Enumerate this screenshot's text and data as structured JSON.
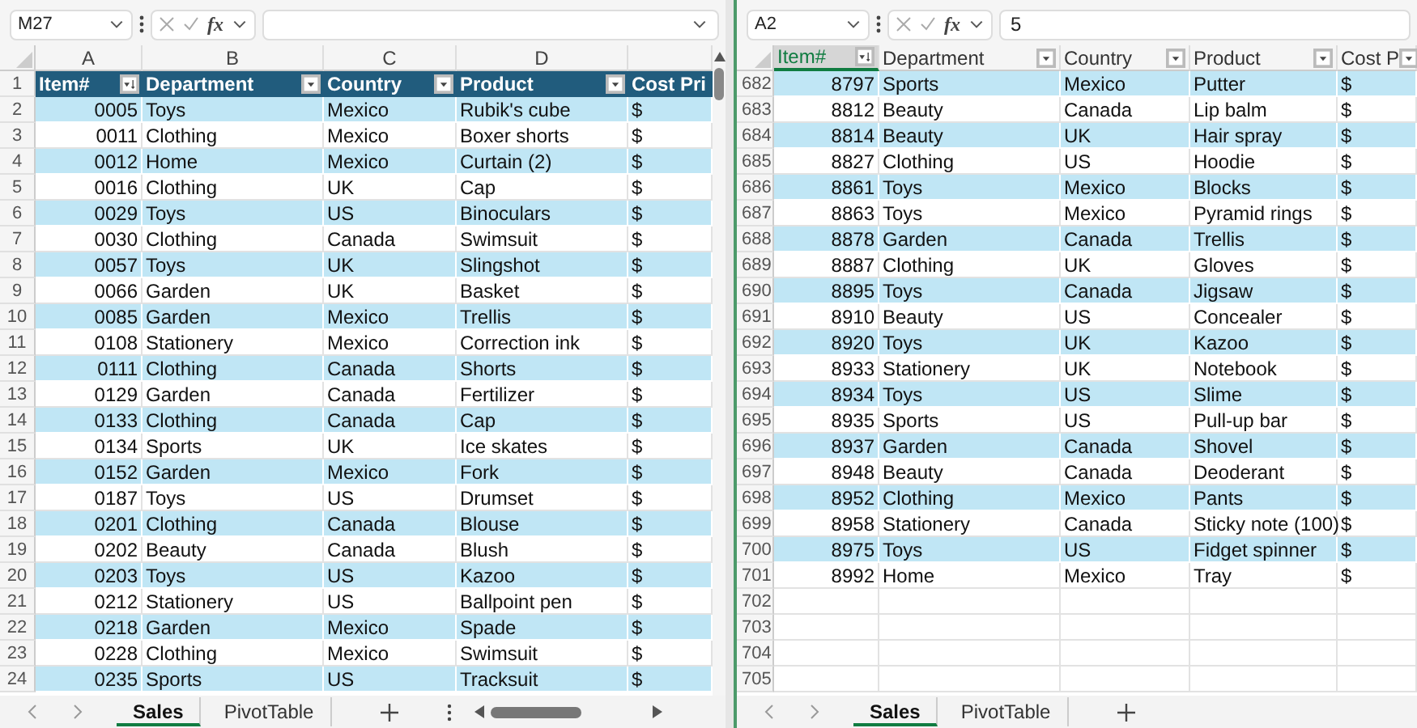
{
  "panes": [
    {
      "name_box": "M27",
      "fx": "fx",
      "column_letters": [
        "A",
        "B",
        "C",
        "D"
      ],
      "header": {
        "row_number": "1",
        "cells": [
          {
            "label": "Item#",
            "kind": "sort"
          },
          {
            "label": "Department",
            "kind": "filter"
          },
          {
            "label": "Country",
            "kind": "filter"
          },
          {
            "label": "Product",
            "kind": "filter"
          },
          {
            "label": "Cost Pri",
            "kind": "plain"
          }
        ]
      },
      "rows": [
        {
          "num": "2",
          "cells": [
            "0005",
            "Toys",
            "Mexico",
            "Rubik's cube",
            "$"
          ]
        },
        {
          "num": "3",
          "cells": [
            "0011",
            "Clothing",
            "Mexico",
            "Boxer shorts",
            "$"
          ]
        },
        {
          "num": "4",
          "cells": [
            "0012",
            "Home",
            "Mexico",
            "Curtain (2)",
            "$"
          ]
        },
        {
          "num": "5",
          "cells": [
            "0016",
            "Clothing",
            "UK",
            "Cap",
            "$"
          ]
        },
        {
          "num": "6",
          "cells": [
            "0029",
            "Toys",
            "US",
            "Binoculars",
            "$"
          ]
        },
        {
          "num": "7",
          "cells": [
            "0030",
            "Clothing",
            "Canada",
            "Swimsuit",
            "$"
          ]
        },
        {
          "num": "8",
          "cells": [
            "0057",
            "Toys",
            "UK",
            "Slingshot",
            "$"
          ]
        },
        {
          "num": "9",
          "cells": [
            "0066",
            "Garden",
            "UK",
            "Basket",
            "$"
          ]
        },
        {
          "num": "10",
          "cells": [
            "0085",
            "Garden",
            "Mexico",
            "Trellis",
            "$"
          ]
        },
        {
          "num": "11",
          "cells": [
            "0108",
            "Stationery",
            "Mexico",
            "Correction ink",
            "$"
          ]
        },
        {
          "num": "12",
          "cells": [
            "0111",
            "Clothing",
            "Canada",
            "Shorts",
            "$"
          ]
        },
        {
          "num": "13",
          "cells": [
            "0129",
            "Garden",
            "Canada",
            "Fertilizer",
            "$"
          ]
        },
        {
          "num": "14",
          "cells": [
            "0133",
            "Clothing",
            "Canada",
            "Cap",
            "$"
          ]
        },
        {
          "num": "15",
          "cells": [
            "0134",
            "Sports",
            "UK",
            "Ice skates",
            "$"
          ]
        },
        {
          "num": "16",
          "cells": [
            "0152",
            "Garden",
            "Mexico",
            "Fork",
            "$"
          ]
        },
        {
          "num": "17",
          "cells": [
            "0187",
            "Toys",
            "US",
            "Drumset",
            "$"
          ]
        },
        {
          "num": "18",
          "cells": [
            "0201",
            "Clothing",
            "Canada",
            "Blouse",
            "$"
          ]
        },
        {
          "num": "19",
          "cells": [
            "0202",
            "Beauty",
            "Canada",
            "Blush",
            "$"
          ]
        },
        {
          "num": "20",
          "cells": [
            "0203",
            "Toys",
            "US",
            "Kazoo",
            "$"
          ]
        },
        {
          "num": "21",
          "cells": [
            "0212",
            "Stationery",
            "US",
            "Ballpoint pen",
            "$"
          ]
        },
        {
          "num": "22",
          "cells": [
            "0218",
            "Garden",
            "Mexico",
            "Spade",
            "$"
          ]
        },
        {
          "num": "23",
          "cells": [
            "0228",
            "Clothing",
            "Mexico",
            "Swimsuit",
            "$"
          ]
        },
        {
          "num": "24",
          "cells": [
            "0235",
            "Sports",
            "US",
            "Tracksuit",
            "$"
          ]
        }
      ],
      "sheets": [
        {
          "label": "Sales",
          "selected": true
        },
        {
          "label": "PivotTable",
          "selected": false
        }
      ]
    },
    {
      "name_box": "A2",
      "fx": "fx",
      "formula": "5",
      "header": {
        "cells": [
          {
            "label": "Item#",
            "kind": "sort",
            "selected": true
          },
          {
            "label": "Department",
            "kind": "filter",
            "selected": false
          },
          {
            "label": "Country",
            "kind": "filter",
            "selected": false
          },
          {
            "label": "Product",
            "kind": "filter",
            "selected": false
          },
          {
            "label": "Cost P",
            "kind": "filter",
            "selected": false
          }
        ]
      },
      "rows": [
        {
          "num": "682",
          "cells": [
            "8797",
            "Sports",
            "Mexico",
            "Putter",
            "$"
          ]
        },
        {
          "num": "683",
          "cells": [
            "8812",
            "Beauty",
            "Canada",
            "Lip balm",
            "$"
          ]
        },
        {
          "num": "684",
          "cells": [
            "8814",
            "Beauty",
            "UK",
            "Hair spray",
            "$"
          ]
        },
        {
          "num": "685",
          "cells": [
            "8827",
            "Clothing",
            "US",
            "Hoodie",
            "$"
          ]
        },
        {
          "num": "686",
          "cells": [
            "8861",
            "Toys",
            "Mexico",
            "Blocks",
            "$"
          ]
        },
        {
          "num": "687",
          "cells": [
            "8863",
            "Toys",
            "Mexico",
            "Pyramid rings",
            "$"
          ]
        },
        {
          "num": "688",
          "cells": [
            "8878",
            "Garden",
            "Canada",
            "Trellis",
            "$"
          ]
        },
        {
          "num": "689",
          "cells": [
            "8887",
            "Clothing",
            "UK",
            "Gloves",
            "$"
          ]
        },
        {
          "num": "690",
          "cells": [
            "8895",
            "Toys",
            "Canada",
            "Jigsaw",
            "$"
          ]
        },
        {
          "num": "691",
          "cells": [
            "8910",
            "Beauty",
            "US",
            "Concealer",
            "$"
          ]
        },
        {
          "num": "692",
          "cells": [
            "8920",
            "Toys",
            "UK",
            "Kazoo",
            "$"
          ]
        },
        {
          "num": "693",
          "cells": [
            "8933",
            "Stationery",
            "UK",
            "Notebook",
            "$"
          ]
        },
        {
          "num": "694",
          "cells": [
            "8934",
            "Toys",
            "US",
            "Slime",
            "$"
          ]
        },
        {
          "num": "695",
          "cells": [
            "8935",
            "Sports",
            "US",
            "Pull-up bar",
            "$"
          ]
        },
        {
          "num": "696",
          "cells": [
            "8937",
            "Garden",
            "Canada",
            "Shovel",
            "$"
          ]
        },
        {
          "num": "697",
          "cells": [
            "8948",
            "Beauty",
            "Canada",
            "Deoderant",
            "$"
          ]
        },
        {
          "num": "698",
          "cells": [
            "8952",
            "Clothing",
            "Mexico",
            "Pants",
            "$"
          ]
        },
        {
          "num": "699",
          "cells": [
            "8958",
            "Stationery",
            "Canada",
            "Sticky note (100)",
            "$"
          ]
        },
        {
          "num": "700",
          "cells": [
            "8975",
            "Toys",
            "US",
            "Fidget spinner",
            "$"
          ]
        },
        {
          "num": "701",
          "cells": [
            "8992",
            "Home",
            "Mexico",
            "Tray",
            "$"
          ]
        },
        {
          "num": "702",
          "cells": []
        },
        {
          "num": "703",
          "cells": []
        },
        {
          "num": "704",
          "cells": []
        },
        {
          "num": "705",
          "cells": []
        }
      ],
      "sheets": [
        {
          "label": "Sales",
          "selected": true
        },
        {
          "label": "PivotTable",
          "selected": false
        }
      ]
    }
  ]
}
